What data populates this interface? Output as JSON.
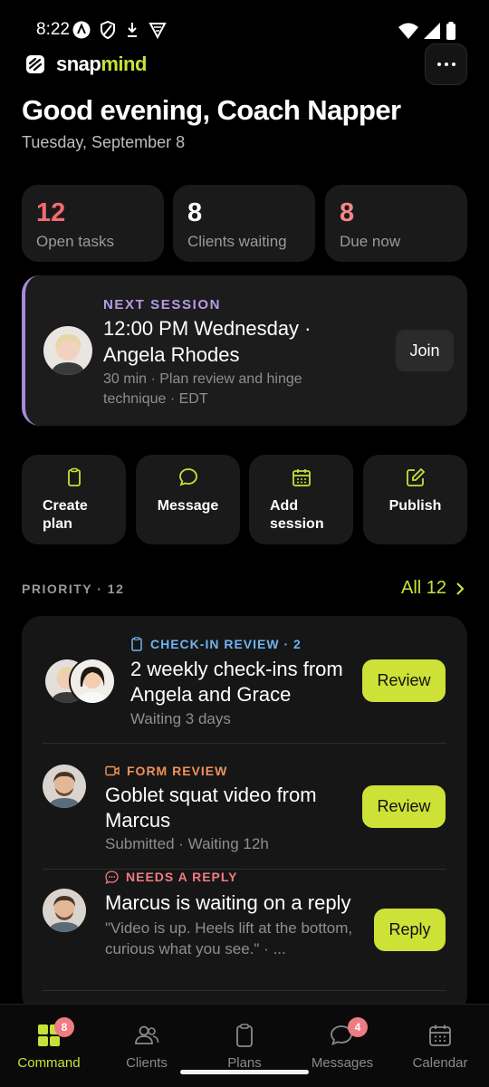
{
  "status_bar": {
    "time": "8:22"
  },
  "brand": {
    "name_part1": "snap",
    "name_part2": "mind"
  },
  "header": {
    "greeting": "Good evening, Coach Napper",
    "date": "Tuesday, September 8"
  },
  "stats": [
    {
      "value": "12",
      "label": "Open tasks",
      "color": "#f26b70"
    },
    {
      "value": "8",
      "label": "Clients waiting",
      "color": "#ffffff"
    },
    {
      "value": "8",
      "label": "Due now",
      "color": "#f3858b"
    }
  ],
  "next_session": {
    "kicker": "NEXT SESSION",
    "title": "12:00 PM Wednesday · Angela Rhodes",
    "subtitle": "30 min · Plan review and hinge technique · EDT",
    "join_label": "Join"
  },
  "actions": [
    {
      "label": "Create plan",
      "icon": "clipboard-icon"
    },
    {
      "label": "Message",
      "icon": "chat-icon"
    },
    {
      "label": "Add session",
      "icon": "calendar-icon"
    },
    {
      "label": "Publish",
      "icon": "edit-icon"
    }
  ],
  "priority": {
    "label": "PRIORITY · 12",
    "all_label": "All 12",
    "items": [
      {
        "kicker": "CHECK-IN REVIEW · 2",
        "kicker_color": "#6fb3f2",
        "title": "2 weekly check-ins from Angela and Grace",
        "subtitle": "Waiting 3 days",
        "button": "Review"
      },
      {
        "kicker": "FORM REVIEW",
        "kicker_color": "#f0925a",
        "title": "Goblet squat video from Marcus",
        "subtitle": "Submitted · Waiting 12h",
        "button": "Review"
      },
      {
        "kicker": "NEEDS A REPLY",
        "kicker_color": "#f07b82",
        "title": "Marcus is waiting on a reply",
        "subtitle": "\"Video is up. Heels lift at the bottom, curious what you see.\" · ...",
        "button": "Reply"
      }
    ]
  },
  "nav": [
    {
      "label": "Command",
      "icon": "grid-icon",
      "active": true,
      "badge": "8"
    },
    {
      "label": "Clients",
      "icon": "users-icon",
      "active": false
    },
    {
      "label": "Plans",
      "icon": "clipboard-icon",
      "active": false
    },
    {
      "label": "Messages",
      "icon": "chat-icon",
      "active": false,
      "badge": "4"
    },
    {
      "label": "Calendar",
      "icon": "calendar-icon",
      "active": false
    }
  ]
}
